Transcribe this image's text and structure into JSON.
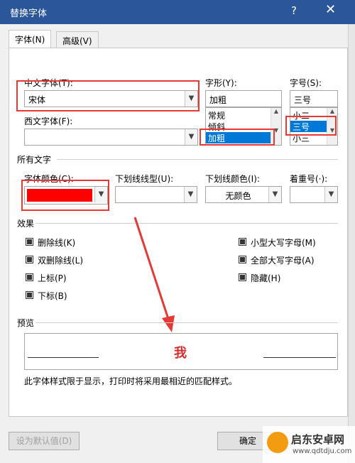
{
  "window": {
    "title": "替换字体",
    "help": "?",
    "close": "✕"
  },
  "tabs": [
    {
      "label": "字体(N)"
    },
    {
      "label": "高级(V)"
    }
  ],
  "font": {
    "chinese_label": "中文字体(T):",
    "chinese_value": "宋体",
    "western_label": "西文字体(F):",
    "western_value": "",
    "style_label": "字形(Y):",
    "style_value": "加粗",
    "style_options": [
      "常规",
      "倾斜",
      "加粗"
    ],
    "size_label": "字号(S):",
    "size_value": "三号",
    "size_options": [
      "小二",
      "三号",
      "小三"
    ]
  },
  "all_text": {
    "section": "所有文字",
    "color_label": "字体颜色(C):",
    "color_value": "#ff0000",
    "underline_label": "下划线线型(U):",
    "underline_value": "",
    "underline_color_label": "下划线颜色(I):",
    "underline_color_value": "无颜色",
    "emphasis_label": "着重号(·):",
    "emphasis_value": ""
  },
  "effects": {
    "section": "效果",
    "left": [
      "删除线(K)",
      "双删除线(L)",
      "上标(P)",
      "下标(B)"
    ],
    "right": [
      "小型大写字母(M)",
      "全部大写字母(A)",
      "隐藏(H)"
    ]
  },
  "preview": {
    "section": "预览",
    "sample": "我",
    "sample_color": "#d32f2f",
    "note": "此字体样式限于显示，打印时将采用最相近的匹配样式。"
  },
  "buttons": {
    "default": "设为默认值(D)",
    "ok": "确定"
  },
  "icons": {
    "dropdown": "chevron-down-icon"
  },
  "watermark": {
    "text": "启东安卓网",
    "url": "www.qdtdju.com"
  },
  "accent_color": "#2b579a",
  "highlight_color": "#e53935"
}
